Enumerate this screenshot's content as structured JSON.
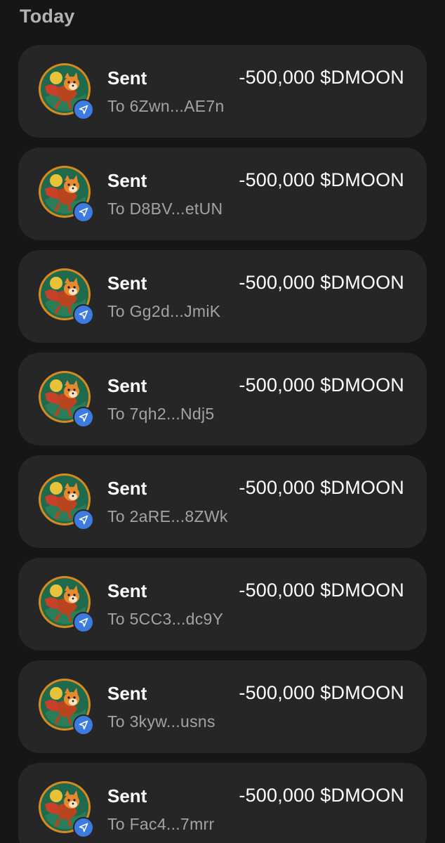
{
  "section": {
    "title": "Today"
  },
  "token": {
    "icon": "dmoon-token-icon"
  },
  "badge": {
    "icon": "send-arrow-icon",
    "color": "#3d7be0"
  },
  "transactions": [
    {
      "type": "Sent",
      "amount": "-500,000 $DMOON",
      "recipient": "To 6Zwn...AE7n"
    },
    {
      "type": "Sent",
      "amount": "-500,000 $DMOON",
      "recipient": "To D8BV...etUN"
    },
    {
      "type": "Sent",
      "amount": "-500,000 $DMOON",
      "recipient": "To Gg2d...JmiK"
    },
    {
      "type": "Sent",
      "amount": "-500,000 $DMOON",
      "recipient": "To 7qh2...Ndj5"
    },
    {
      "type": "Sent",
      "amount": "-500,000 $DMOON",
      "recipient": "To 2aRE...8ZWk"
    },
    {
      "type": "Sent",
      "amount": "-500,000 $DMOON",
      "recipient": "To 5CC3...dc9Y"
    },
    {
      "type": "Sent",
      "amount": "-500,000 $DMOON",
      "recipient": "To 3kyw...usns"
    },
    {
      "type": "Sent",
      "amount": "-500,000 $DMOON",
      "recipient": "To Fac4...7mrr"
    }
  ]
}
